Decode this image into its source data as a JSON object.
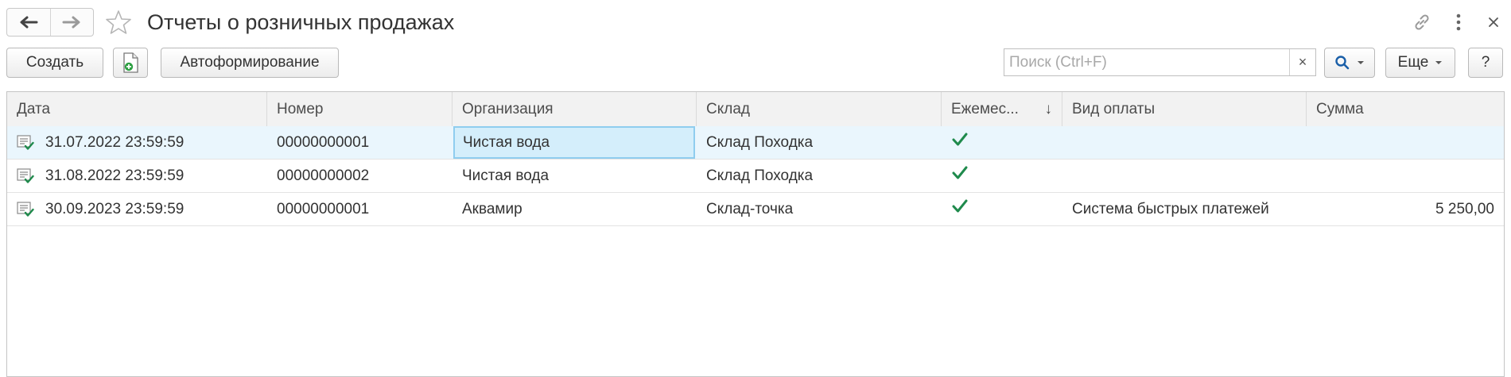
{
  "window": {
    "title": "Отчеты о розничных продажах"
  },
  "toolbar": {
    "create_label": "Создать",
    "autoform_label": "Автоформирование",
    "more_label": "Еще",
    "help_label": "?"
  },
  "search": {
    "placeholder": "Поиск (Ctrl+F)",
    "value": "",
    "clear_label": "×"
  },
  "table": {
    "columns": [
      {
        "label": "Дата"
      },
      {
        "label": "Номер"
      },
      {
        "label": "Организация"
      },
      {
        "label": "Склад"
      },
      {
        "label": "Ежемес...",
        "sort_indicator": "↓"
      },
      {
        "label": "Вид оплаты"
      },
      {
        "label": "Сумма"
      }
    ],
    "rows": [
      {
        "date": "31.07.2022 23:59:59",
        "number": "00000000001",
        "organization": "Чистая вода",
        "warehouse": "Склад Походка",
        "monthly": true,
        "payment_type": "",
        "amount": "",
        "selected": true
      },
      {
        "date": "31.08.2022 23:59:59",
        "number": "00000000002",
        "organization": "Чистая вода",
        "warehouse": "Склад Походка",
        "monthly": true,
        "payment_type": "",
        "amount": "",
        "selected": false
      },
      {
        "date": "30.09.2023 23:59:59",
        "number": "00000000001",
        "organization": "Аквамир",
        "warehouse": "Склад-точка",
        "monthly": true,
        "payment_type": "Система быстрых платежей",
        "amount": "5 250,00",
        "selected": false
      }
    ]
  },
  "colors": {
    "selected_row": "#eaf6fd",
    "focused_cell": "#d4eefb",
    "check_green": "#1f8a4c",
    "search_blue": "#1a5fa8"
  }
}
